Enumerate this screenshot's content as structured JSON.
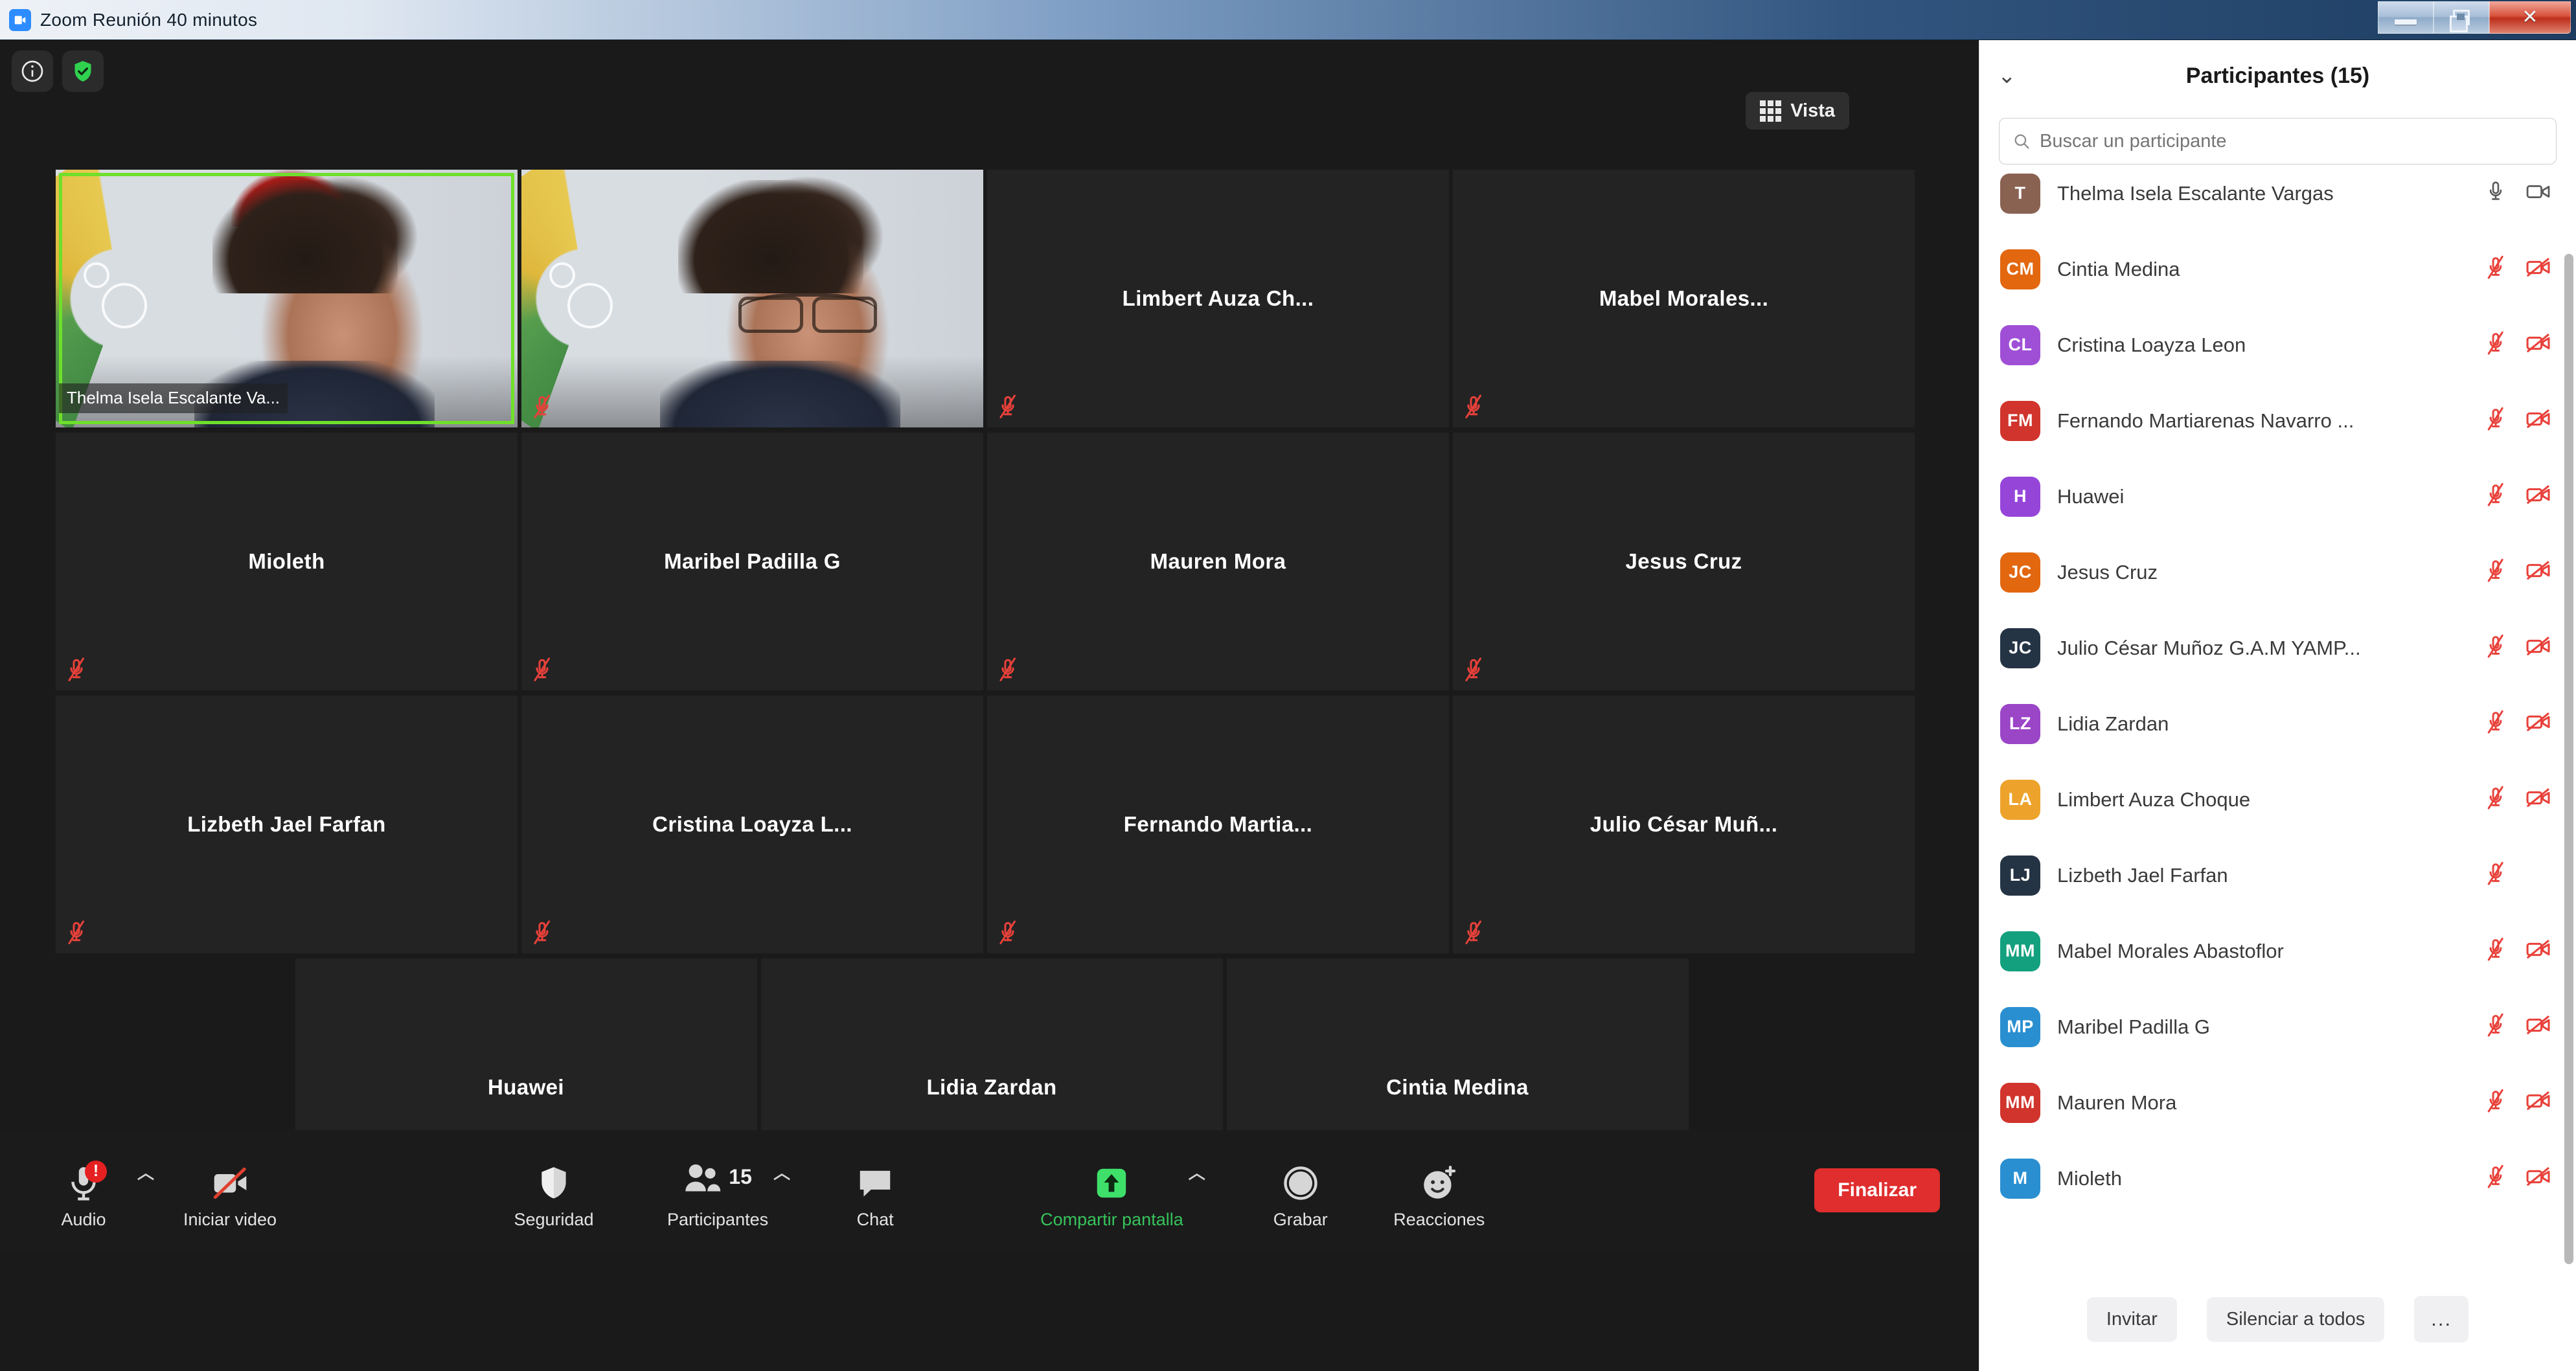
{
  "window": {
    "title": "Zoom Reunión 40 minutos",
    "app_icon": "zoom-camera-icon",
    "minimize_label": "Minimizar",
    "restore_label": "Restaurar",
    "close_label": "Cerrar"
  },
  "stage": {
    "info_icon": "info-icon",
    "shield_icon": "encryption-shield-icon",
    "view_button": {
      "label": "Vista",
      "icon": "grid-view-icon"
    }
  },
  "tiles": [
    [
      {
        "name": "Thelma Isela Escalante Va...",
        "video": true,
        "active_speaker": true,
        "muted": false,
        "label_position": "badge",
        "person": "woman"
      },
      {
        "name": "",
        "video": true,
        "active_speaker": false,
        "muted": true,
        "label_position": "none",
        "person": "man"
      },
      {
        "name": "Limbert Auza Ch...",
        "video": false,
        "active_speaker": false,
        "muted": true,
        "label_position": "center"
      },
      {
        "name": "Mabel  Morales...",
        "video": false,
        "active_speaker": false,
        "muted": true,
        "label_position": "center"
      }
    ],
    [
      {
        "name": "Mioleth",
        "video": false,
        "active_speaker": false,
        "muted": true,
        "label_position": "center"
      },
      {
        "name": "Maribel Padilla G",
        "video": false,
        "active_speaker": false,
        "muted": true,
        "label_position": "center"
      },
      {
        "name": "Mauren Mora",
        "video": false,
        "active_speaker": false,
        "muted": true,
        "label_position": "center"
      },
      {
        "name": "Jesus Cruz",
        "video": false,
        "active_speaker": false,
        "muted": true,
        "label_position": "center"
      }
    ],
    [
      {
        "name": "Lizbeth Jael Farfan",
        "video": false,
        "active_speaker": false,
        "muted": true,
        "label_position": "center"
      },
      {
        "name": "Cristina Loayza L...",
        "video": false,
        "active_speaker": false,
        "muted": true,
        "label_position": "center"
      },
      {
        "name": "Fernando  Martia...",
        "video": false,
        "active_speaker": false,
        "muted": true,
        "label_position": "center"
      },
      {
        "name": "Julio César Muñ...",
        "video": false,
        "active_speaker": false,
        "muted": true,
        "label_position": "center"
      }
    ],
    [
      {
        "name": "Huawei",
        "video": false,
        "active_speaker": false,
        "muted": true,
        "label_position": "center"
      },
      {
        "name": "Lidia Zardan",
        "video": false,
        "active_speaker": false,
        "muted": true,
        "label_position": "center"
      },
      {
        "name": "Cintia Medina",
        "video": false,
        "active_speaker": false,
        "muted": true,
        "label_position": "center"
      }
    ]
  ],
  "toolbar": {
    "audio": {
      "label": "Audio",
      "icon": "microphone-alert-icon",
      "badge": "!",
      "has_caret": true
    },
    "video": {
      "label": "Iniciar video",
      "icon": "camera-off-icon",
      "has_caret": false
    },
    "security": {
      "label": "Seguridad",
      "icon": "shield-icon",
      "has_caret": false
    },
    "participants": {
      "label": "Participantes",
      "icon": "people-icon",
      "count": "15",
      "has_caret": true
    },
    "chat": {
      "label": "Chat",
      "icon": "chat-bubble-icon",
      "has_caret": false
    },
    "share": {
      "label": "Compartir pantalla",
      "icon": "share-screen-up-arrow-icon",
      "has_caret": true,
      "accent": "#36c35b"
    },
    "record": {
      "label": "Grabar",
      "icon": "record-circle-icon",
      "has_caret": false
    },
    "reactions": {
      "label": "Reacciones",
      "icon": "smiley-plus-icon",
      "has_caret": false
    },
    "end": {
      "label": "Finalizar",
      "color": "#e02d2d"
    }
  },
  "panel": {
    "collapse_icon": "chevron-down-icon",
    "title": "Participantes (15)",
    "search": {
      "placeholder": "Buscar un participante",
      "icon": "search-icon",
      "value": ""
    },
    "participants": [
      {
        "initials": "T",
        "name": "Thelma Isela Escalante Vargas",
        "color": "#8a6252",
        "mic": "on",
        "cam": "on"
      },
      {
        "initials": "CM",
        "name": "Cintia Medina",
        "color": "#e2670f",
        "mic": "muted",
        "cam": "off"
      },
      {
        "initials": "CL",
        "name": "Cristina Loayza Leon",
        "color": "#9f4fd6",
        "mic": "muted",
        "cam": "off"
      },
      {
        "initials": "FM",
        "name": "Fernando Martiarenas Navarro ...",
        "color": "#d0342c",
        "mic": "muted",
        "cam": "off"
      },
      {
        "initials": "H",
        "name": "Huawei",
        "color": "#9645d9",
        "mic": "muted",
        "cam": "off"
      },
      {
        "initials": "JC",
        "name": "Jesus Cruz",
        "color": "#e2670f",
        "mic": "muted",
        "cam": "off"
      },
      {
        "initials": "JC",
        "name": "Julio César Muñoz G.A.M YAMP...",
        "color": "#253444",
        "mic": "muted",
        "cam": "off"
      },
      {
        "initials": "LZ",
        "name": "Lidia Zardan",
        "color": "#9b45c7",
        "mic": "muted",
        "cam": "off"
      },
      {
        "initials": "LA",
        "name": "Limbert Auza Choque",
        "color": "#eda32b",
        "mic": "muted",
        "cam": "off"
      },
      {
        "initials": "LJ",
        "name": "Lizbeth Jael Farfan",
        "color": "#253444",
        "mic": "muted",
        "cam": "none"
      },
      {
        "initials": "MM",
        "name": "Mabel Morales Abastoflor",
        "color": "#13a07e",
        "mic": "muted",
        "cam": "off"
      },
      {
        "initials": "MP",
        "name": "Maribel Padilla G",
        "color": "#2a8fd0",
        "mic": "muted",
        "cam": "off"
      },
      {
        "initials": "MM",
        "name": "Mauren Mora",
        "color": "#d0342c",
        "mic": "muted",
        "cam": "off"
      },
      {
        "initials": "M",
        "name": "Mioleth",
        "color": "#2a8fd0",
        "mic": "muted",
        "cam": "off"
      }
    ],
    "footer": {
      "invite_label": "Invitar",
      "mute_all_label": "Silenciar a todos",
      "more_label": "..."
    }
  }
}
